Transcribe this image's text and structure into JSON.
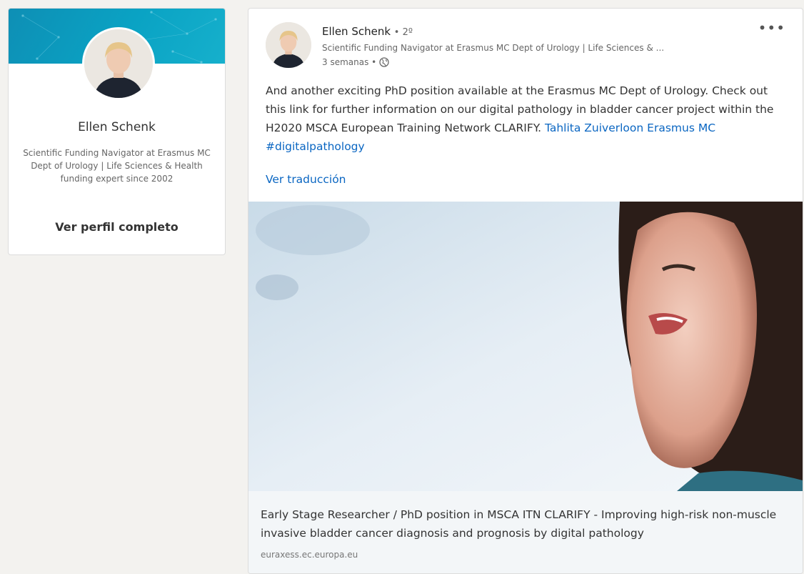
{
  "profile": {
    "name": "Ellen Schenk",
    "headline": "Scientific Funding Navigator at Erasmus MC Dept of Urology | Life Sciences & Health funding expert since 2002",
    "view_profile": "Ver perfil completo"
  },
  "post": {
    "author": "Ellen Schenk",
    "degree": "• 2º",
    "author_headline": "Scientific Funding Navigator at Erasmus MC Dept of Urology | Life Sciences & ...",
    "time": "3 semanas •",
    "text": "And another exciting PhD position available at the Erasmus MC Dept of Urology. Check out this link for further information on our digital pathology in bladder cancer project within the H2020 MSCA European Training Network CLARIFY.",
    "mention_1": "Tahlita Zuiverloon",
    "mention_2": "Erasmus MC",
    "hashtag": "#digitalpathology",
    "translate": "Ver traducción",
    "more": "•••"
  },
  "preview": {
    "title": "Early Stage Researcher / PhD position in MSCA ITN CLARIFY - Improving high-risk non-muscle invasive bladder cancer diagnosis and prognosis by digital pathology",
    "domain": "euraxess.ec.europa.eu"
  },
  "colors": {
    "accent": "#0a66c2",
    "cover": "#0aa3c4"
  }
}
